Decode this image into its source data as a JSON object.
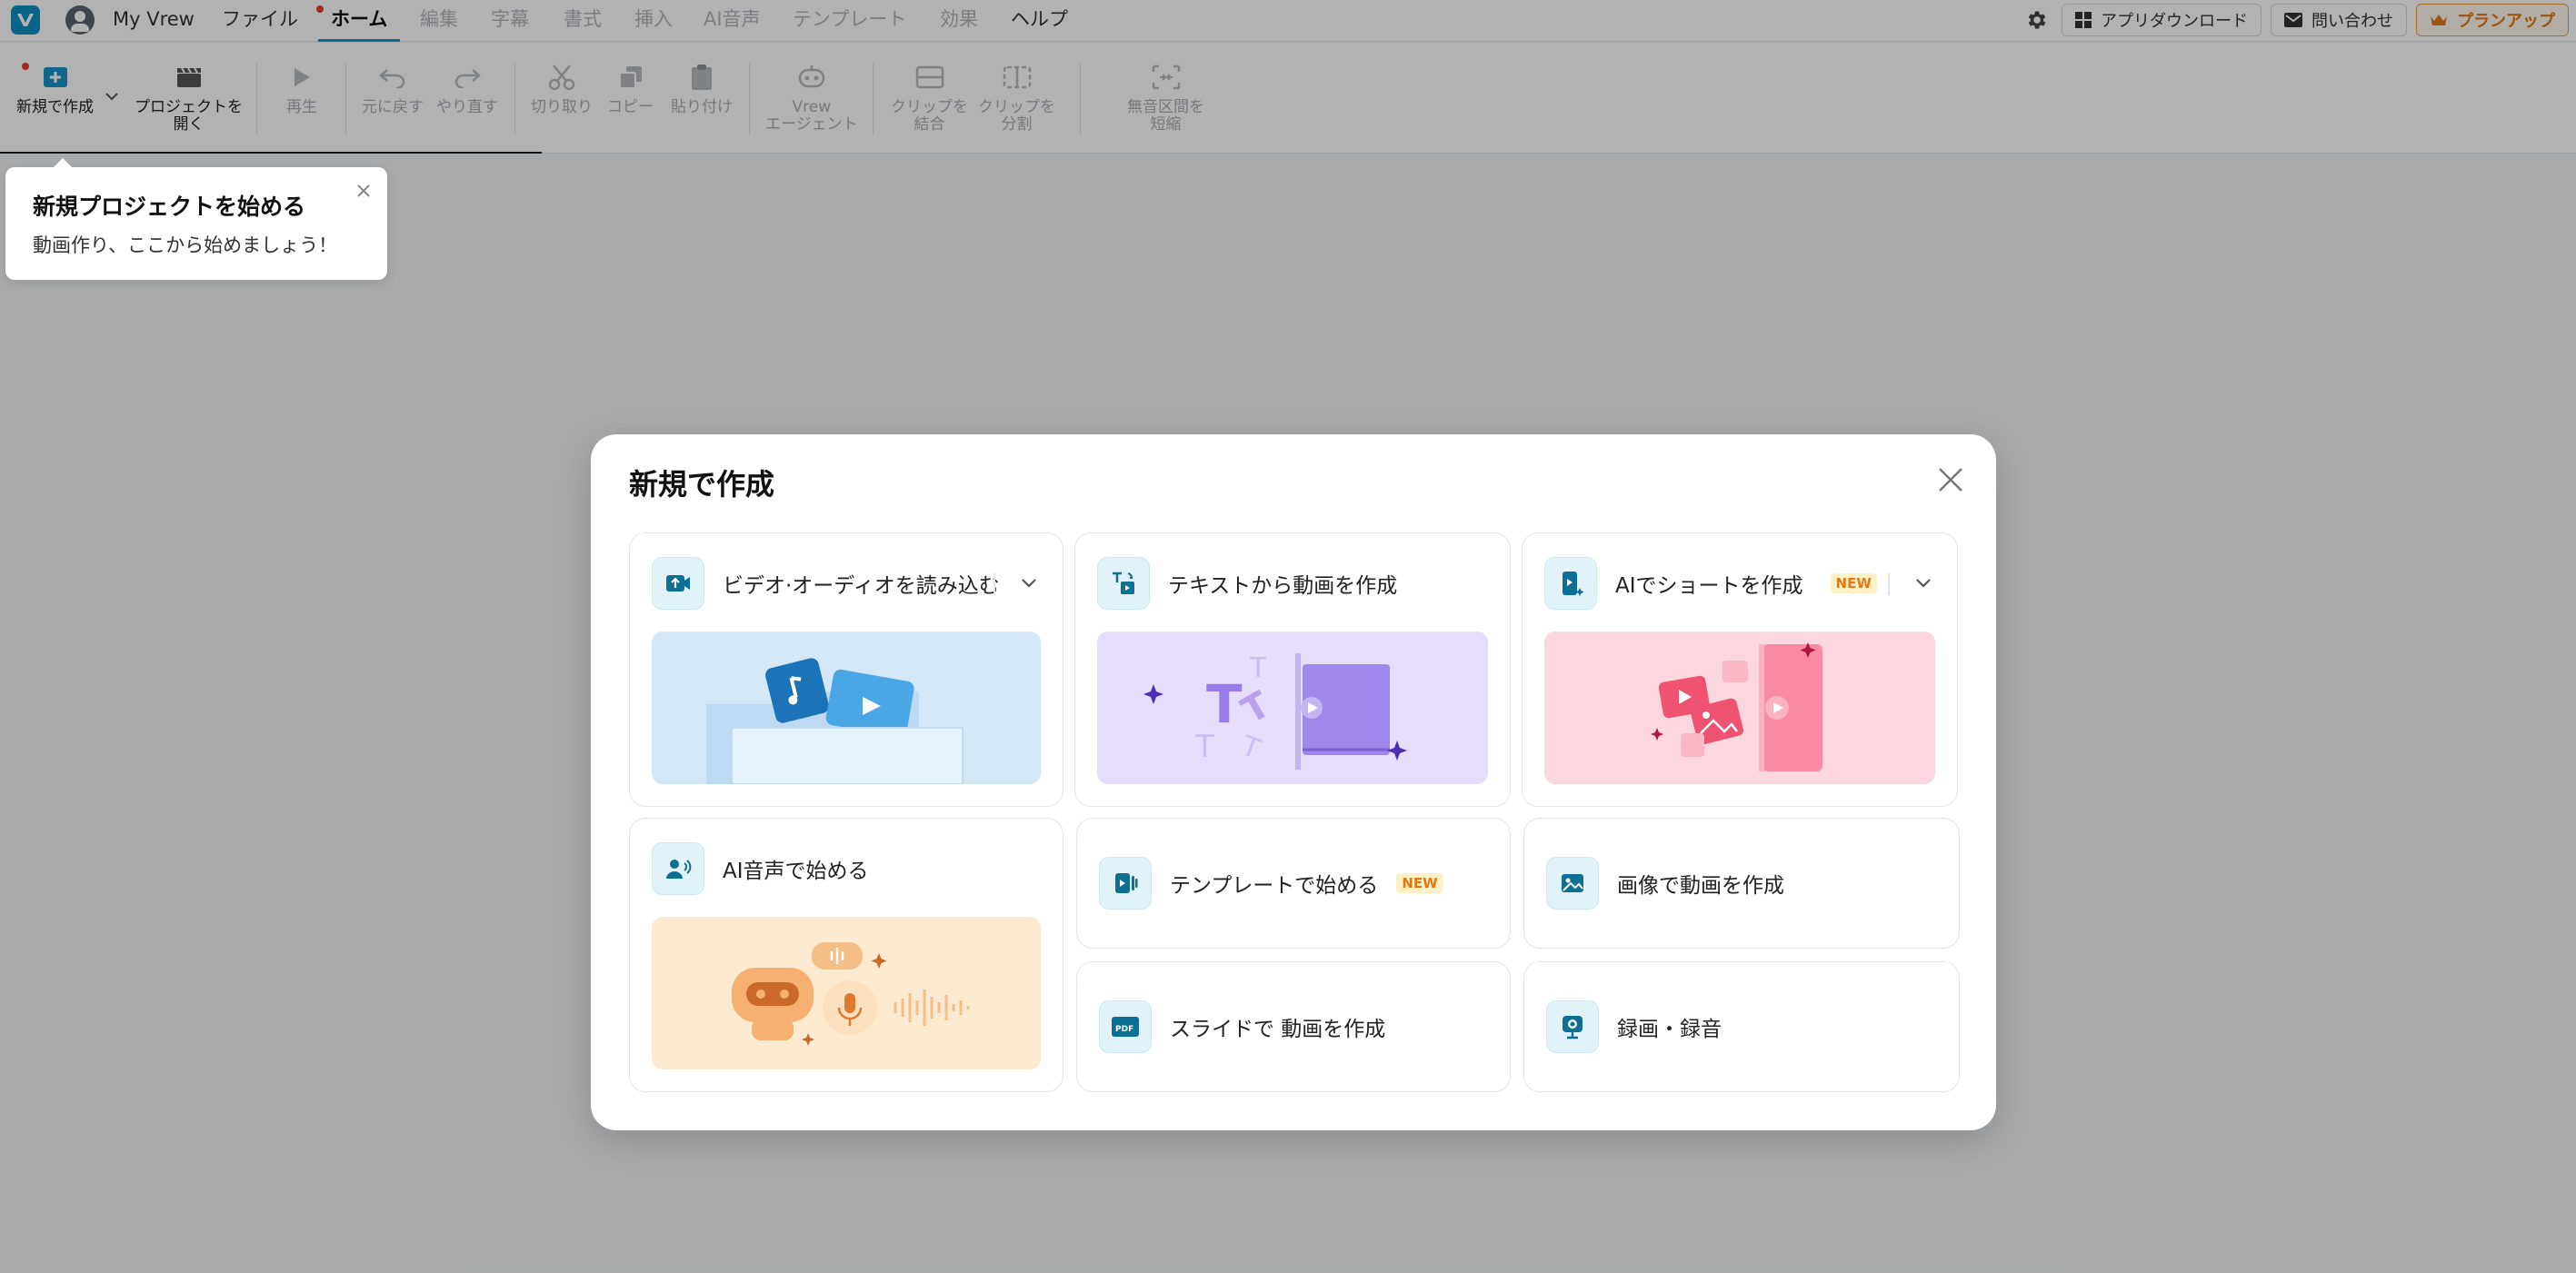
{
  "menubar": {
    "profile_name": "My Vrew",
    "menus": [
      "ファイル",
      "ホーム",
      "編集",
      "字幕",
      "書式",
      "挿入",
      "AI音声",
      "テンプレート",
      "効果",
      "ヘルプ"
    ],
    "download_label": "アプリダウンロード",
    "contact_label": "問い合わせ",
    "plan_label": "プランアップ"
  },
  "ribbon": {
    "new_create": "新規で作成",
    "open_project": "プロジェクトを\n開く",
    "play": "再生",
    "undo": "元に戻す",
    "redo": "やり直す",
    "cut": "切り取り",
    "copy": "コピー",
    "paste": "貼り付け",
    "vrew_agent": "Vrew\nエージェント",
    "merge_clips": "クリップを\n結合",
    "split_clip": "クリップを\n分割",
    "shorten_silence": "無音区間を\n短縮"
  },
  "tooltip": {
    "title": "新規プロジェクトを始める",
    "text": "動画作り、ここから始めましょう！"
  },
  "modal": {
    "title": "新規で作成",
    "new_badge": "NEW",
    "cards": {
      "import_media": "ビデオ·オーディオを読み込む",
      "text_to_video": "テキストから動画を作成",
      "ai_shorts": "AIでショートを作成",
      "ai_voice": "AI音声で始める",
      "template": "テンプレートで始める",
      "image_to_video": "画像で動画を作成",
      "slide_to_video": "スライドで 動画を作成",
      "record": "録画・録音"
    }
  },
  "colors": {
    "accent": "#1793c7",
    "plan": "#e07a12",
    "illus_blue": "#d3e7f7",
    "illus_purple": "#e6dcfb",
    "illus_pink": "#fdd7e0",
    "illus_orange": "#fdebd1"
  }
}
